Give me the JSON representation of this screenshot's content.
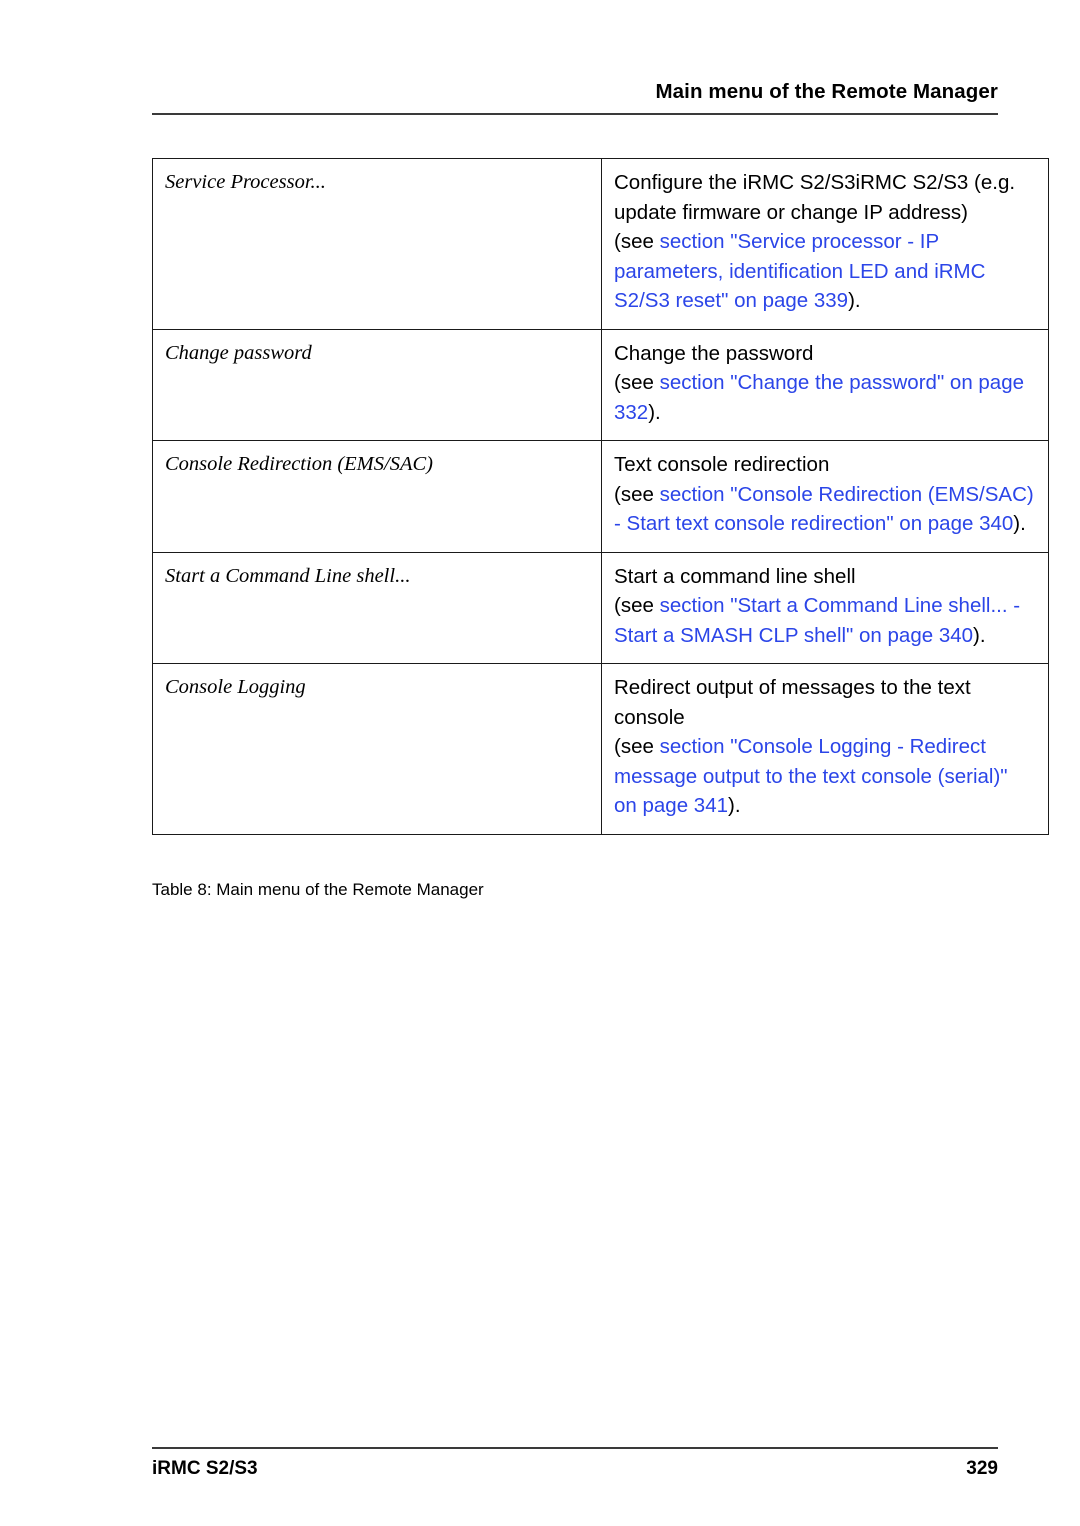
{
  "header": {
    "title": "Main menu of the Remote Manager"
  },
  "table": {
    "caption": "Table 8: Main menu of the Remote Manager",
    "rows": [
      {
        "term": "Service Processor...",
        "description": "Configure the iRMC S2/S3iRMC S2/S3 (e.g. update firmware or change IP address)",
        "ref_open": "(see ",
        "ref_link": "section \"Service processor - IP parameters, identification LED and iRMC S2/S3 reset\" on page 339",
        "ref_close": ")."
      },
      {
        "term": "Change password",
        "description": "Change the password",
        "ref_open": "(see ",
        "ref_link": "section \"Change the password\" on page 332",
        "ref_close": ")."
      },
      {
        "term": "Console Redirection (EMS/SAC)",
        "description": "Text console redirection",
        "ref_open": "(see ",
        "ref_link": "section \"Console Redirection (EMS/SAC) - Start text console redirection\" on page 340",
        "ref_close": ")."
      },
      {
        "term": "Start a Command Line shell...",
        "description": "Start a command line shell",
        "ref_open": "(see ",
        "ref_link": "section \"Start a Command Line shell... - Start a SMASH CLP shell\" on page 340",
        "ref_close": ")."
      },
      {
        "term": "Console Logging",
        "description": "Redirect output of messages to the text console",
        "ref_open": "(see ",
        "ref_link": "section \"Console Logging - Redirect message output to the text console (serial)\" on page 341",
        "ref_close": ")."
      }
    ]
  },
  "footer": {
    "document": "iRMC S2/S3",
    "page_number": "329"
  },
  "colors": {
    "link": "#2b45e8",
    "text": "#000000",
    "rule": "#3a3a3a",
    "border": "#1a1a1a"
  }
}
